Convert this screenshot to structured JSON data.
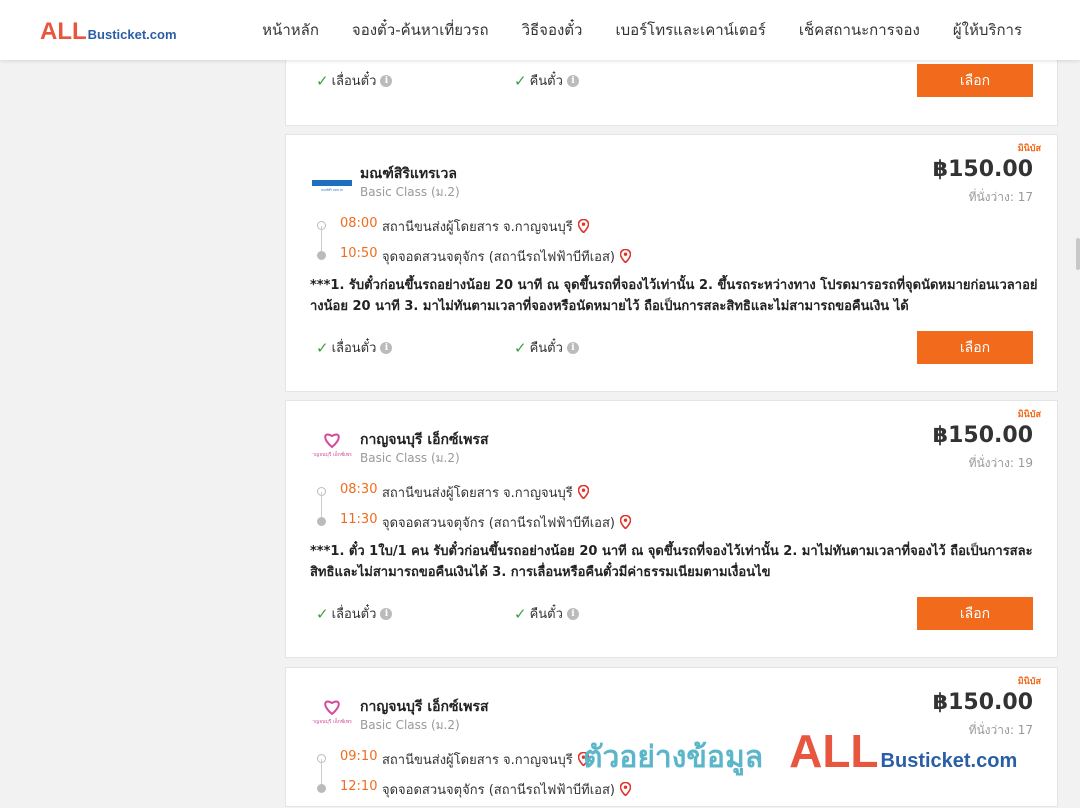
{
  "header": {
    "logo_all": "ALL",
    "logo_rest": "Busticket.com",
    "nav": [
      "หน้าหลัก",
      "จองตั๋ว-ค้นหาเที่ยวรถ",
      "วิธีจองตั๋ว",
      "เบอร์โทรและเคาน์เตอร์",
      "เช็คสถานะการจอง",
      "ผู้ให้บริการ"
    ]
  },
  "top_card": {
    "change_label": "เลื่อนตั๋ว",
    "refund_label": "คืนตั๋ว",
    "select_label": "เลือก"
  },
  "cards": [
    {
      "tag": "มินิบัส",
      "operator": "มณฑ์สิริแทรเวล",
      "class": "Basic Class (ม.2)",
      "price": "฿150.00",
      "seats": "ที่นั่งว่าง: 17",
      "depart_time": "08:00",
      "depart_place": "สถานีขนส่งผู้โดยสาร จ.กาญจนบุรี",
      "arrive_time": "10:50",
      "arrive_place": "จุดจอดสวนจตุจักร (สถานีรถไฟฟ้าบีทีเอส)",
      "note": "***1. รับตั๋วก่อนขึ้นรถอย่างน้อย 20 นาที ณ จุดขึ้นรถที่จองไว้เท่านั้น 2. ขึ้นรถระหว่างทาง โปรดมารอรถที่จุดนัดหมายก่อนเวลาอย่างน้อย 20 นาที 3. มาไม่ทันตามเวลาที่จองหรือนัดหมายไว้ ถือเป็นการสละสิทธิและไม่สามารถขอคืนเงิน ได้",
      "change_label": "เลื่อนตั๋ว",
      "refund_label": "คืนตั๋ว",
      "select_label": "เลือก",
      "logo_text": "มณฑ์สิริ แทรเวล"
    },
    {
      "tag": "มินิบัส",
      "operator": "กาญจนบุรี เอ็กซ์เพรส",
      "class": "Basic Class (ม.2)",
      "price": "฿150.00",
      "seats": "ที่นั่งว่าง: 19",
      "depart_time": "08:30",
      "depart_place": "สถานีขนส่งผู้โดยสาร จ.กาญจนบุรี",
      "arrive_time": "11:30",
      "arrive_place": "จุดจอดสวนจตุจักร (สถานีรถไฟฟ้าบีทีเอส)",
      "note": "***1. ตั๋ว 1ใบ/1 คน รับตั๋วก่อนขึ้นรถอย่างน้อย 20 นาที ณ จุดขึ้นรถที่จองไว้เท่านั้น 2. มาไม่ทันตามเวลาที่จองไว้ ถือเป็นการสละสิทธิและไม่สามารถขอคืนเงินได้ 3. การเลื่อนหรือคืนตั๋วมีค่าธรรมเนียมตามเงื่อนไข",
      "change_label": "เลื่อนตั๋ว",
      "refund_label": "คืนตั๋ว",
      "select_label": "เลือก",
      "logo_text": "กาญจนบุรี เอ็กซ์เพรส"
    },
    {
      "tag": "มินิบัส",
      "operator": "กาญจนบุรี เอ็กซ์เพรส",
      "class": "Basic Class (ม.2)",
      "price": "฿150.00",
      "seats": "ที่นั่งว่าง: 17",
      "depart_time": "09:10",
      "depart_place": "สถานีขนส่งผู้โดยสาร จ.กาญจนบุรี",
      "arrive_time": "12:10",
      "arrive_place": "จุดจอดสวนจตุจักร (สถานีรถไฟฟ้าบีทีเอส)",
      "logo_text": "กาญจนบุรี เอ็กซ์เพรส"
    }
  ],
  "watermark": {
    "thai": "ตัวอย่างข้อมูล",
    "all": "ALL",
    "rest": "Busticket.com"
  },
  "colors": {
    "accent": "#f26b1d",
    "check": "#3aa142",
    "logo_red": "#e8563f",
    "logo_blue": "#2a5fa8"
  }
}
